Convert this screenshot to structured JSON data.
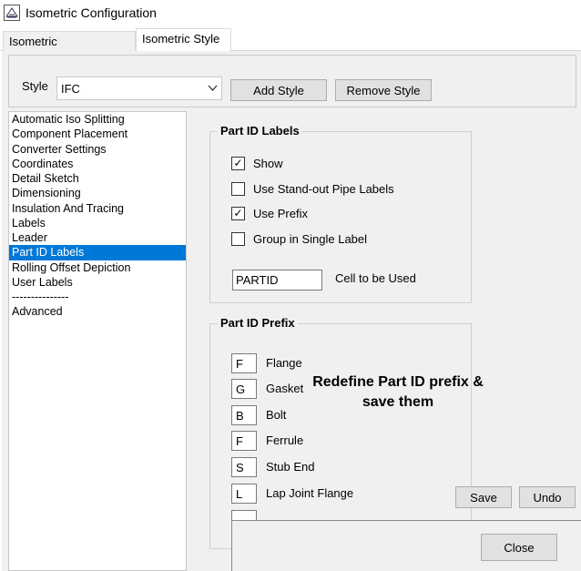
{
  "window": {
    "title": "Isometric Configuration"
  },
  "icons": {
    "app": "isometric-app-icon",
    "dropdown": "chevron-down-icon",
    "checked": "✓"
  },
  "tabs": [
    {
      "label": "Isometric Management",
      "active": false
    },
    {
      "label": "Isometric Style",
      "active": true
    }
  ],
  "style_bar": {
    "label": "Style",
    "selected": "IFC",
    "add_label": "Add Style",
    "remove_label": "Remove Style"
  },
  "nav": {
    "items": [
      "Automatic Iso Splitting",
      "Component Placement",
      "Converter Settings",
      "Coordinates",
      "Detail Sketch",
      "Dimensioning",
      "Insulation And Tracing",
      "Labels",
      "Leader",
      "Part ID Labels",
      "Rolling Offset Depiction",
      "User Labels",
      "---------------",
      "Advanced"
    ],
    "selected_index": 9
  },
  "part_id_labels": {
    "legend": "Part ID Labels",
    "options": [
      {
        "label": "Show",
        "checked": true
      },
      {
        "label": "Use Stand-out Pipe Labels",
        "checked": false
      },
      {
        "label": "Use Prefix",
        "checked": true
      },
      {
        "label": "Group in Single Label",
        "checked": false
      }
    ],
    "cell_value": "PARTID",
    "cell_label": "Cell to be Used"
  },
  "part_id_prefix": {
    "legend": "Part ID Prefix",
    "rows": [
      {
        "prefix": "F",
        "label": "Flange"
      },
      {
        "prefix": "G",
        "label": "Gasket"
      },
      {
        "prefix": "B",
        "label": "Bolt"
      },
      {
        "prefix": "F",
        "label": "Ferrule"
      },
      {
        "prefix": "S",
        "label": "Stub End"
      },
      {
        "prefix": "L",
        "label": "Lap Joint Flange"
      }
    ]
  },
  "annotation": {
    "text": "Redefine Part ID prefix & save them"
  },
  "actions": {
    "save_label": "Save",
    "undo_label": "Undo",
    "close_label": "Close"
  }
}
